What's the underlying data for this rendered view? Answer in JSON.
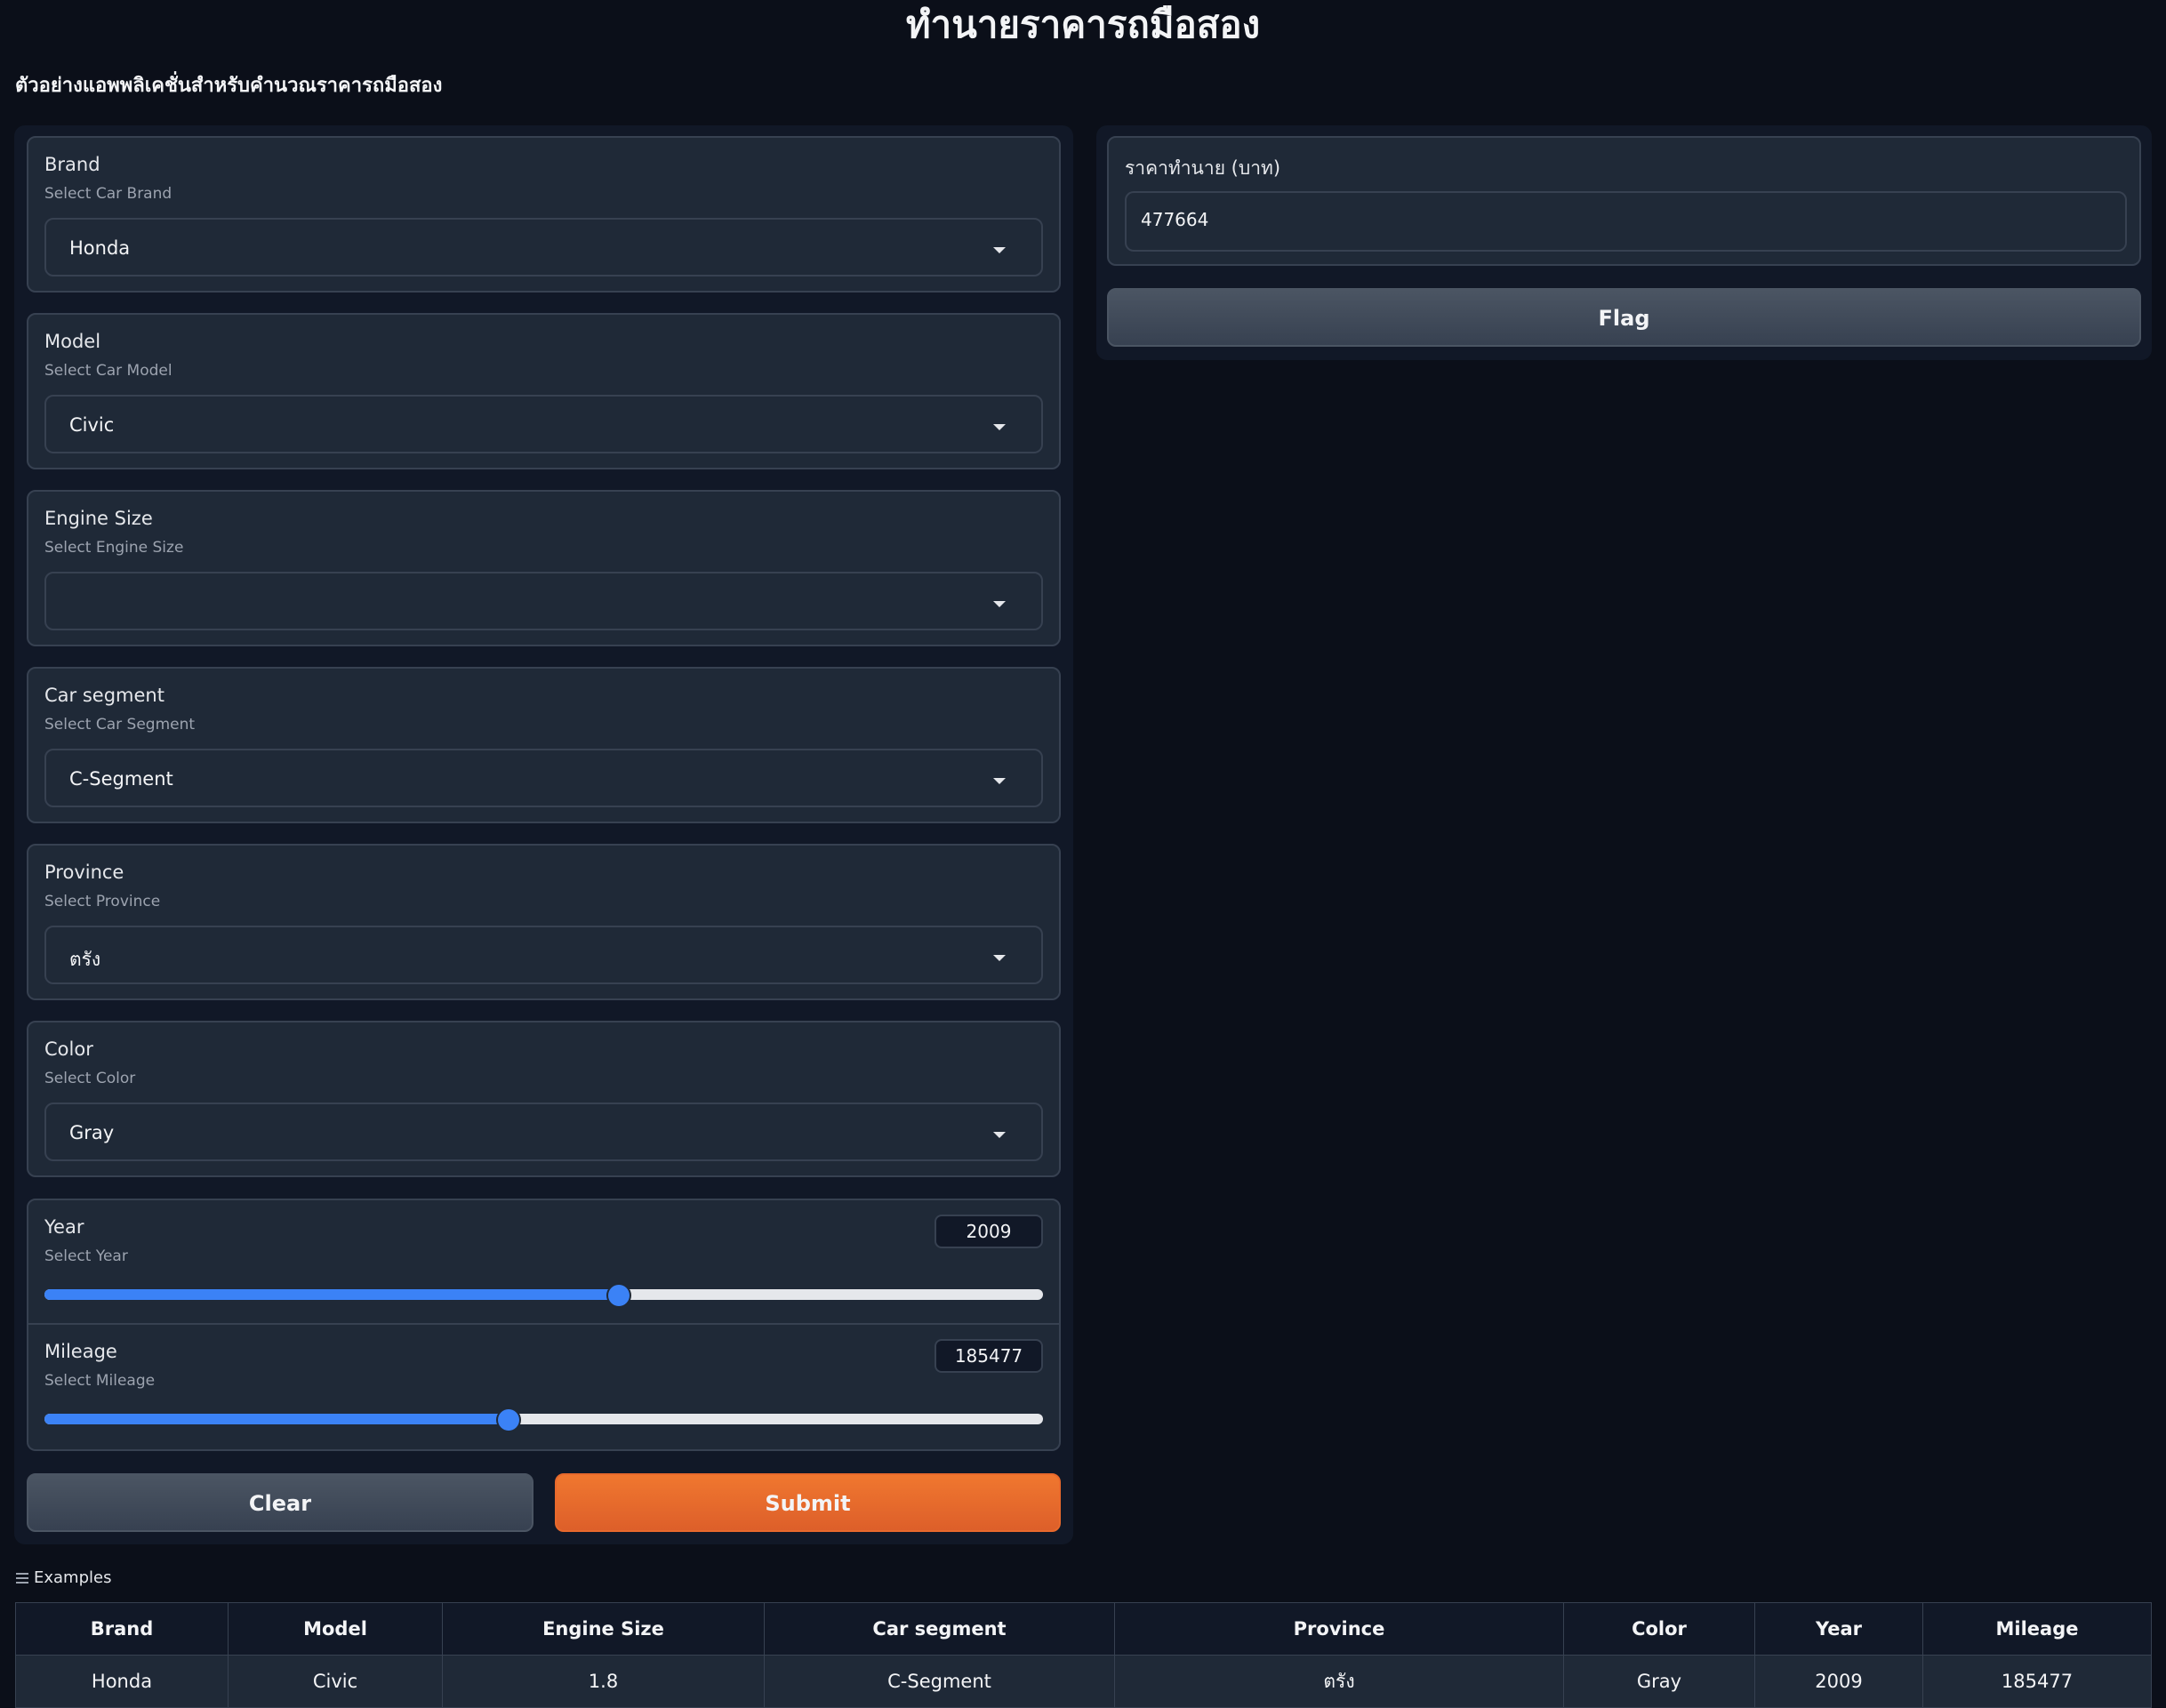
{
  "header": {
    "title": "ทำนายราคารถมือสอง",
    "subtitle": "ตัวอย่างแอพพลิเคชั่นสำหรับคำนวณราคารถมือสอง"
  },
  "inputs": {
    "brand": {
      "label": "Brand",
      "info": "Select Car Brand",
      "value": "Honda"
    },
    "model": {
      "label": "Model",
      "info": "Select Car Model",
      "value": "Civic"
    },
    "engine": {
      "label": "Engine Size",
      "info": "Select Engine Size",
      "value": ""
    },
    "segment": {
      "label": "Car segment",
      "info": "Select Car Segment",
      "value": "C-Segment"
    },
    "province": {
      "label": "Province",
      "info": "Select Province",
      "value": "ตรัง"
    },
    "color": {
      "label": "Color",
      "info": "Select Color",
      "value": "Gray"
    },
    "year": {
      "label": "Year",
      "info": "Select Year",
      "value": "2009",
      "fraction": 0.575
    },
    "mileage": {
      "label": "Mileage",
      "info": "Select Mileage",
      "value": "185477",
      "fraction": 0.465
    }
  },
  "buttons": {
    "clear": "Clear",
    "submit": "Submit",
    "flag": "Flag"
  },
  "output": {
    "label": "ราคาทำนาย (บาท)",
    "value": "477664"
  },
  "examples": {
    "title": "Examples",
    "columns": [
      "Brand",
      "Model",
      "Engine Size",
      "Car segment",
      "Province",
      "Color",
      "Year",
      "Mileage"
    ],
    "rows": [
      [
        "Honda",
        "Civic",
        "1.8",
        "C-Segment",
        "ตรัง",
        "Gray",
        "2009",
        "185477"
      ]
    ]
  },
  "colors": {
    "accent": "#3b82f6",
    "submit": "#e8692c",
    "background": "#0b0f19"
  }
}
